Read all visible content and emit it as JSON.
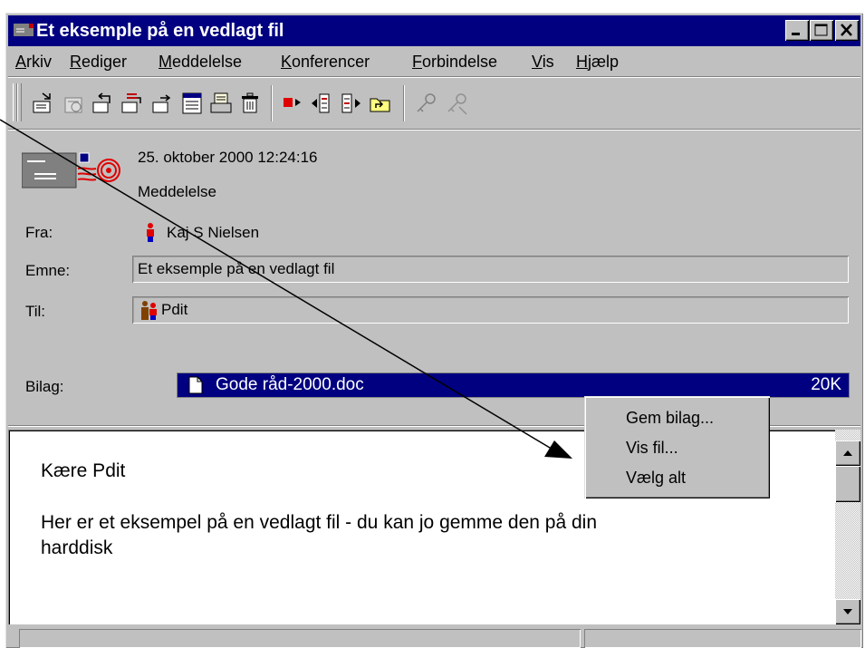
{
  "window": {
    "title": "Et eksemple på en vedlagt fil",
    "controls": [
      "minimize-icon",
      "maximize-icon",
      "close-icon"
    ]
  },
  "menu": [
    {
      "first": "A",
      "rest": "rkiv"
    },
    {
      "first": "R",
      "rest": "ediger"
    },
    {
      "first": "M",
      "rest": "eddelelse"
    },
    {
      "first": "K",
      "rest": "onferencer"
    },
    {
      "first": "F",
      "rest": "orbindelse"
    },
    {
      "first": "V",
      "rest": "is"
    },
    {
      "first": "H",
      "rest": "jælp"
    }
  ],
  "toolbar": {
    "icons": [
      "new-message-icon",
      "forward-icon",
      "reply-icon",
      "reply-all-icon",
      "send-icon",
      "address-book-icon",
      "print-icon",
      "delete-icon",
      "flag-icon",
      "previous-icon",
      "next-icon",
      "move-folder-icon",
      "key-icon",
      "key-disabled-icon"
    ]
  },
  "header": {
    "date": "25. oktober 2000 12:24:16",
    "type": "Meddelelse",
    "from_label": "Fra:",
    "from_value": "Kaj S Nielsen",
    "subject_label": "Emne:",
    "subject_value": "Et eksemple på en vedlagt fil",
    "to_label": "Til:",
    "to_value": "Pdit",
    "attachment_label": "Bilag:",
    "attachment": {
      "name": "Gode råd-2000.doc",
      "size": "20K"
    }
  },
  "message": {
    "greeting": "Kære Pdit",
    "line1": "Her er et eksempel på en vedlagt fil - du kan jo gemme den på din",
    "line2": "harddisk"
  },
  "context_menu": {
    "items": [
      "Gem bilag...",
      "Vis fil...",
      "Vælg alt"
    ]
  },
  "colors": {
    "titlebar": "#000080",
    "face": "#c0c0c0",
    "selection": "#000080"
  }
}
